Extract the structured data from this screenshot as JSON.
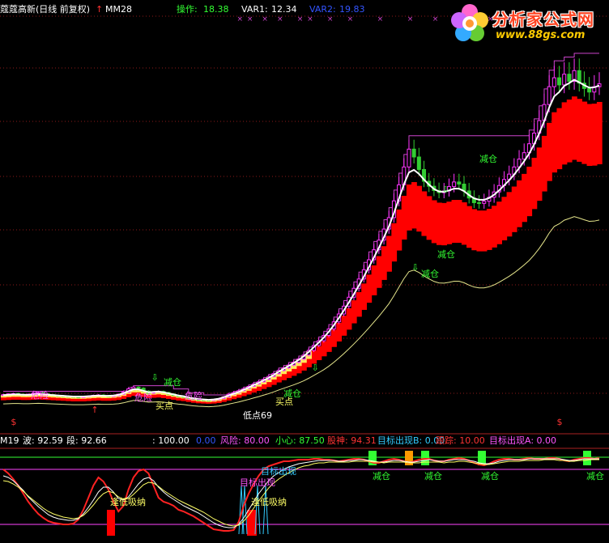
{
  "top_header": {
    "title": "蔻蔻高新(日线 前复权)",
    "indicator_name": "MM28",
    "indicators": [
      {
        "label": "操作:",
        "value": "18.38",
        "color": "#33ff33"
      },
      {
        "label": "VAR1:",
        "value": "12.34",
        "color": "#ffffff"
      },
      {
        "label": "VAR2:",
        "value": "19.83",
        "color": "#3355ff"
      }
    ]
  },
  "logo": {
    "text": "分析家公式网",
    "url": "www.88gs.com"
  },
  "sub_header": {
    "items": [
      {
        "text": "M19",
        "color": "#ffffff"
      },
      {
        "text": "波: 92.59",
        "color": "#ffffff"
      },
      {
        "text": "段: 92.66",
        "color": "#ffffff"
      },
      {
        "text": ": 100.00",
        "color": "#ffffff"
      },
      {
        "text": "0.00",
        "color": "#3355ff"
      },
      {
        "text": "风险: 80.00",
        "color": "#ff55ff"
      },
      {
        "text": "小心: 87.50",
        "color": "#33ff33"
      },
      {
        "text": "股神: 94.31",
        "color": "#ff3333"
      },
      {
        "text": "目标出现B: 0.00",
        "color": "#33ccff"
      },
      {
        "text": "跟踪: 10.00",
        "color": "#ff3333"
      },
      {
        "text": "目标出现A: 0.00",
        "color": "#ff55ff"
      }
    ]
  },
  "colors": {
    "candle_up": "#ff33ff",
    "bar_red": "#ff0000",
    "ma_white": "#ffffff",
    "band_yellow": "#ffff66",
    "baseline_khaki": "#e6e68c",
    "resistance_magenta": "#cc44cc",
    "signal_green": "#33ff33"
  },
  "chart_data": [
    {
      "type": "line",
      "panel": "main",
      "x": [
        0,
        1,
        2,
        3,
        4,
        5,
        6,
        7,
        8,
        9,
        10,
        11,
        12,
        13,
        14,
        15,
        16,
        17,
        18,
        19,
        20,
        21,
        22,
        23,
        24,
        25,
        26,
        27,
        28,
        29,
        30,
        31,
        32,
        33,
        34,
        35,
        36,
        37,
        38,
        39,
        40,
        41,
        42,
        43,
        44,
        45,
        46,
        47,
        48,
        49,
        50,
        51,
        52,
        53,
        54,
        55,
        56,
        57,
        58,
        59,
        60,
        61,
        62,
        63,
        64,
        65,
        66,
        67,
        68,
        69,
        70,
        71,
        72,
        73,
        74,
        75,
        76,
        77,
        78,
        79,
        80,
        81,
        82,
        83,
        84,
        85,
        86,
        87,
        88,
        89,
        90,
        91,
        92,
        93,
        94,
        95,
        96,
        97,
        98,
        99,
        100,
        101,
        102,
        103,
        104,
        105,
        106,
        107,
        108,
        109,
        110,
        111,
        112,
        113,
        114,
        115,
        116,
        117,
        118,
        119
      ],
      "ylim": [
        0,
        105
      ],
      "series": [
        {
          "role": "close",
          "values": [
            6.2,
            6.4,
            6.5,
            6.3,
            6.1,
            6.3,
            6.6,
            6.8,
            6.4,
            6.2,
            6.0,
            5.9,
            5.8,
            5.7,
            5.6,
            5.5,
            5.6,
            5.8,
            6.0,
            6.1,
            5.9,
            5.8,
            5.9,
            6.3,
            6.9,
            7.8,
            8.3,
            8.0,
            7.2,
            6.6,
            6.9,
            7.1,
            6.8,
            6.4,
            6.0,
            5.7,
            5.5,
            5.2,
            4.9,
            4.8,
            4.7,
            4.6,
            4.8,
            5.1,
            5.6,
            6.3,
            6.8,
            7.3,
            7.9,
            8.5,
            9.2,
            9.8,
            10.5,
            11.3,
            12.1,
            13.0,
            13.7,
            14.5,
            15.3,
            16.2,
            17.3,
            18.6,
            20.0,
            21.3,
            22.8,
            24.6,
            26.6,
            28.8,
            31.0,
            33.5,
            36.0,
            38.6,
            41.2,
            44.0,
            46.8,
            49.5,
            52.6,
            55.8,
            60.5,
            65.0,
            70.0,
            75.0,
            72.8,
            69.3,
            66.0,
            64.6,
            63.4,
            62.8,
            63.3,
            64.5,
            65.8,
            65.2,
            63.3,
            61.3,
            60.0,
            59.8,
            60.4,
            61.5,
            63.0,
            64.8,
            66.5,
            68.0,
            70.0,
            72.2,
            74.0,
            76.5,
            79.5,
            83.0,
            87.5,
            92.5,
            95.0,
            93.0,
            96.0,
            94.0,
            97.0,
            93.5,
            92.0,
            91.0,
            92.5,
            93.3
          ]
        },
        {
          "role": "ma_white",
          "values": [
            6.0,
            6.1,
            6.2,
            6.2,
            6.1,
            6.1,
            6.2,
            6.3,
            6.2,
            6.1,
            6.0,
            5.9,
            5.8,
            5.7,
            5.6,
            5.6,
            5.6,
            5.7,
            5.8,
            5.9,
            5.8,
            5.8,
            5.9,
            6.1,
            6.5,
            7.1,
            7.6,
            7.6,
            7.2,
            6.8,
            6.9,
            7.0,
            6.8,
            6.5,
            6.2,
            5.9,
            5.7,
            5.4,
            5.1,
            4.9,
            4.8,
            4.7,
            4.8,
            5.0,
            5.4,
            5.9,
            6.4,
            6.9,
            7.5,
            8.1,
            8.8,
            9.4,
            10.1,
            10.8,
            11.6,
            12.5,
            13.3,
            14.1,
            14.9,
            15.8,
            16.8,
            18.0,
            19.3,
            20.6,
            22.0,
            23.6,
            25.4,
            27.4,
            29.5,
            31.7,
            34.0,
            36.4,
            38.9,
            41.5,
            44.2,
            46.9,
            49.8,
            52.8,
            56.5,
            60.5,
            64.5,
            67.8,
            68.5,
            67.4,
            65.8,
            64.4,
            63.2,
            62.5,
            62.4,
            62.8,
            63.3,
            63.3,
            62.6,
            61.5,
            60.6,
            60.2,
            60.2,
            60.7,
            61.6,
            62.8,
            64.2,
            65.6,
            67.2,
            69.0,
            70.9,
            73.0,
            75.6,
            78.6,
            82.0,
            85.8,
            88.9,
            90.1,
            91.8,
            92.6,
            93.5,
            92.8,
            92.0,
            91.3,
            91.4,
            91.9
          ]
        }
      ],
      "annotations": [
        {
          "text": "危险",
          "color": "#ff55ff"
        },
        {
          "text": "危险",
          "color": "#ff55ff"
        },
        {
          "text": "减仓",
          "color": "#33ff33"
        },
        {
          "text": "危险",
          "color": "#ff55ff"
        },
        {
          "text": "买点",
          "color": "#ffff66"
        },
        {
          "text": "减仓",
          "color": "#33ff33"
        },
        {
          "text": "买点",
          "color": "#ffff66"
        },
        {
          "text": "低点69",
          "color": "#ffffff"
        },
        {
          "text": "减仓",
          "color": "#33ff33"
        },
        {
          "text": "减仓",
          "color": "#33ff33"
        },
        {
          "text": "减仓",
          "color": "#33ff33"
        }
      ]
    },
    {
      "type": "line",
      "panel": "sub",
      "x": [
        0,
        1,
        2,
        3,
        4,
        5,
        6,
        7,
        8,
        9,
        10,
        11,
        12,
        13,
        14,
        15,
        16,
        17,
        18,
        19,
        20,
        21,
        22,
        23,
        24,
        25,
        26,
        27,
        28,
        29,
        30,
        31,
        32,
        33,
        34,
        35,
        36,
        37,
        38,
        39,
        40,
        41,
        42,
        43,
        44,
        45,
        46,
        47,
        48,
        49,
        50,
        51,
        52,
        53,
        54,
        55,
        56,
        57,
        58,
        59,
        60,
        61,
        62,
        63,
        64,
        65,
        66,
        67,
        68,
        69,
        70,
        71,
        72,
        73,
        74,
        75,
        76,
        77,
        78,
        79,
        80,
        81,
        82,
        83,
        84,
        85,
        86,
        87,
        88,
        89,
        90,
        91,
        92,
        93,
        94,
        95,
        96,
        97,
        98,
        99,
        100,
        101,
        102,
        103,
        104,
        105,
        106,
        107,
        108,
        109,
        110,
        111,
        112,
        113,
        114,
        115,
        116,
        117,
        118,
        119
      ],
      "ylim": [
        0,
        100
      ],
      "series": [
        {
          "role": "red",
          "values": [
            80,
            75,
            68,
            60,
            50,
            40,
            32,
            25,
            20,
            16,
            14,
            13,
            12,
            12,
            13,
            18,
            30,
            45,
            60,
            70,
            65,
            55,
            40,
            28,
            35,
            55,
            70,
            78,
            80,
            75,
            60,
            45,
            40,
            38,
            35,
            30,
            28,
            25,
            22,
            18,
            14,
            10,
            6,
            5,
            4,
            4,
            5,
            15,
            35,
            50,
            62,
            72,
            80,
            84,
            86,
            88,
            90,
            90,
            91,
            92,
            92,
            92,
            93,
            93,
            92,
            92,
            91,
            90,
            91,
            92,
            93,
            93,
            92,
            90,
            88,
            88,
            90,
            92,
            93,
            92,
            90,
            88,
            90,
            92,
            93,
            93,
            91,
            90,
            90,
            92,
            93,
            94,
            93,
            91,
            88,
            86,
            85,
            87,
            90,
            92,
            93,
            93,
            92,
            92,
            93,
            94,
            93,
            93,
            93,
            94,
            94,
            93,
            91,
            90,
            92,
            93,
            94,
            94,
            93,
            94
          ]
        },
        {
          "role": "white",
          "values": [
            72,
            70,
            66,
            60,
            54,
            46,
            40,
            34,
            29,
            24,
            21,
            19,
            18,
            17,
            17,
            19,
            25,
            33,
            42,
            52,
            58,
            58,
            52,
            44,
            42,
            46,
            54,
            62,
            68,
            70,
            66,
            58,
            52,
            47,
            43,
            39,
            35,
            32,
            29,
            26,
            22,
            18,
            14,
            11,
            9,
            8,
            8,
            12,
            20,
            30,
            40,
            50,
            58,
            66,
            72,
            76,
            80,
            83,
            85,
            87,
            88,
            89,
            90,
            91,
            91,
            91,
            91,
            90,
            90,
            91,
            91,
            92,
            92,
            91,
            90,
            89,
            89,
            90,
            91,
            91,
            90,
            89,
            89,
            90,
            91,
            92,
            91,
            90,
            90,
            91,
            92,
            92,
            92,
            91,
            90,
            88,
            87,
            87,
            88,
            90,
            91,
            92,
            92,
            92,
            92,
            93,
            93,
            93,
            93,
            93,
            93,
            93,
            92,
            91,
            91,
            92,
            93,
            93,
            93,
            93
          ]
        },
        {
          "role": "yellow",
          "values": [
            66,
            65,
            62,
            58,
            53,
            47,
            42,
            37,
            32,
            28,
            25,
            23,
            21,
            20,
            19,
            20,
            23,
            29,
            36,
            44,
            50,
            53,
            51,
            46,
            43,
            44,
            49,
            55,
            61,
            64,
            63,
            59,
            54,
            50,
            46,
            42,
            39,
            36,
            33,
            30,
            27,
            23,
            19,
            16,
            13,
            11,
            10,
            11,
            16,
            23,
            32,
            41,
            49,
            57,
            63,
            68,
            72,
            76,
            79,
            82,
            84,
            85,
            87,
            88,
            88,
            89,
            89,
            89,
            89,
            89,
            90,
            90,
            90,
            90,
            89,
            89,
            88,
            89,
            89,
            89,
            89,
            88,
            88,
            88,
            89,
            89,
            89,
            89,
            88,
            89,
            89,
            90,
            90,
            89,
            88,
            87,
            86,
            86,
            87,
            88,
            89,
            90,
            90,
            90,
            91,
            91,
            91,
            91,
            92,
            92,
            92,
            91,
            91,
            90,
            90,
            91,
            91,
            92,
            92,
            92
          ]
        }
      ],
      "annotations": [
        {
          "text": "逢低吸纳",
          "color": "#ffff66"
        },
        {
          "text": "逢低吸纳",
          "color": "#ffff66"
        },
        {
          "text": "目标出现",
          "color": "#33ccff"
        },
        {
          "text": "目标出现",
          "color": "#ff55ff"
        },
        {
          "text": "减仓",
          "color": "#33ff33"
        },
        {
          "text": "减仓",
          "color": "#33ff33"
        },
        {
          "text": "减仓",
          "color": "#33ff33"
        },
        {
          "text": "减仓",
          "color": "#33ff33"
        }
      ]
    }
  ]
}
